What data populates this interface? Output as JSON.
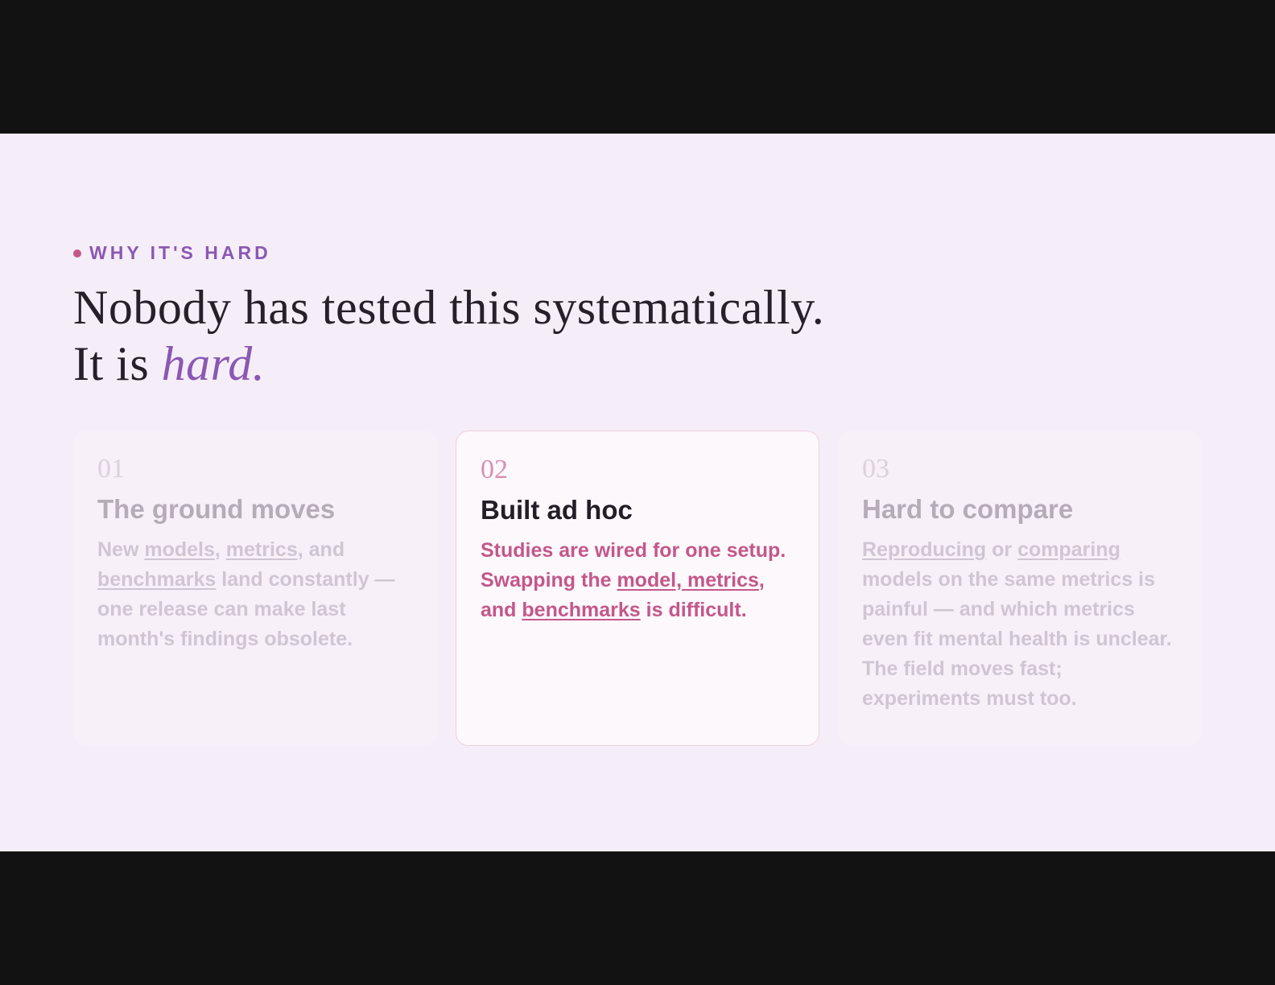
{
  "section": {
    "eyebrow": "WHY IT'S HARD",
    "headline_line1": "Nobody has tested this systematically.",
    "headline_line2_prefix": "It is",
    "headline_line2_emphasis": "hard."
  },
  "cards": [
    {
      "number": "01",
      "title": "The ground moves",
      "body_parts": [
        "New ",
        "models",
        ", ",
        "metrics",
        ", and ",
        "benchmarks",
        " land constantly — one release can make last month's findings obsolete."
      ],
      "state": "dimmed"
    },
    {
      "number": "02",
      "title": "Built ad hoc",
      "body_parts": [
        "Studies are wired for one setup. Swapping the ",
        "model, metrics",
        ", and ",
        "benchmarks",
        " is difficult."
      ],
      "state": "active"
    },
    {
      "number": "03",
      "title": "Hard to compare",
      "body_parts": [
        "",
        "Reproducing",
        " or ",
        "comparing",
        " models on the same metrics is painful — and which metrics even fit mental health is unclear. The field moves fast; experiments must too."
      ],
      "state": "dimmed"
    }
  ],
  "colors": {
    "accent_purple": "#8a58b3",
    "accent_pink": "#c4578a",
    "slide_bg": "#f5eef8",
    "letterbox": "#121212"
  }
}
